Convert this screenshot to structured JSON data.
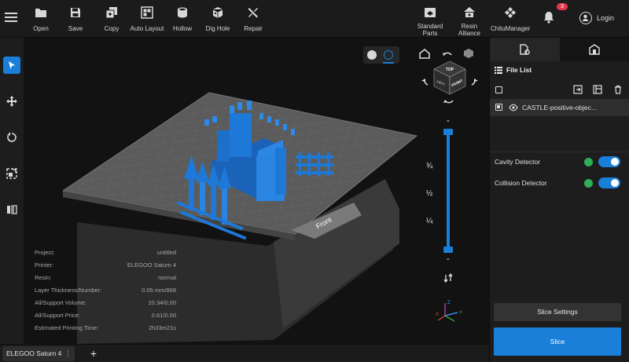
{
  "toolbar": {
    "items": [
      {
        "label": "Open",
        "icon": "folder-icon"
      },
      {
        "label": "Save",
        "icon": "save-icon"
      },
      {
        "label": "Copy",
        "icon": "copy-icon"
      },
      {
        "label": "Auto Layout",
        "icon": "auto-layout-icon"
      },
      {
        "label": "Hollow",
        "icon": "hollow-icon"
      },
      {
        "label": "Dig Hole",
        "icon": "dig-hole-icon"
      },
      {
        "label": "Repair",
        "icon": "repair-icon"
      }
    ],
    "right_items": [
      {
        "label": "Standard\nParts",
        "icon": "standard-parts-icon"
      },
      {
        "label": "Resin\nAlliance",
        "icon": "resin-alliance-icon"
      },
      {
        "label": "ChituManager",
        "icon": "chitumanager-icon"
      }
    ],
    "notification_count": "3",
    "login_label": "Login"
  },
  "viewport": {
    "orientation_cube": {
      "top": "TOP",
      "front": "FRONT",
      "left": "LEFT"
    },
    "plate_front_label": "Front",
    "slider_marks": [
      "¾",
      "½",
      "¼"
    ],
    "axis_labels": {
      "x": "X",
      "y": "Y",
      "z": "Z"
    },
    "layer_slider": {
      "top_fraction": 1.0,
      "bottom_fraction": 0.0
    },
    "info": [
      {
        "label": "Project:",
        "value": "untitled"
      },
      {
        "label": "Printer:",
        "value": "ELEGOO Saturn 4"
      },
      {
        "label": "Resin:",
        "value": "normal"
      },
      {
        "label": "Layer Thickness/Number:",
        "value": "0.05 mm/868"
      },
      {
        "label": "All/Support Volume:",
        "value": "20.34/0.00"
      },
      {
        "label": "All/Support Price:",
        "value": "0.61/0.00"
      },
      {
        "label": "Estimated Printing Time:",
        "value": "2h33m21s"
      }
    ]
  },
  "panel": {
    "file_list_title": "File List",
    "files": [
      {
        "name": "CASTLE-positive-objec..."
      }
    ],
    "detectors": [
      {
        "label": "Cavity Detector",
        "enabled": true
      },
      {
        "label": "Collision Detector",
        "enabled": true
      }
    ],
    "slice_settings_label": "Slice Settings",
    "slice_label": "Slice"
  },
  "bottom": {
    "tabs": [
      {
        "label": "ELEGOO Saturn 4"
      }
    ],
    "more_label": "⋮",
    "add_label": "+"
  },
  "colors": {
    "accent": "#1a7fd8",
    "model": "#1e78d8",
    "status_ok": "#2fae58",
    "badge": "#e6374b"
  }
}
